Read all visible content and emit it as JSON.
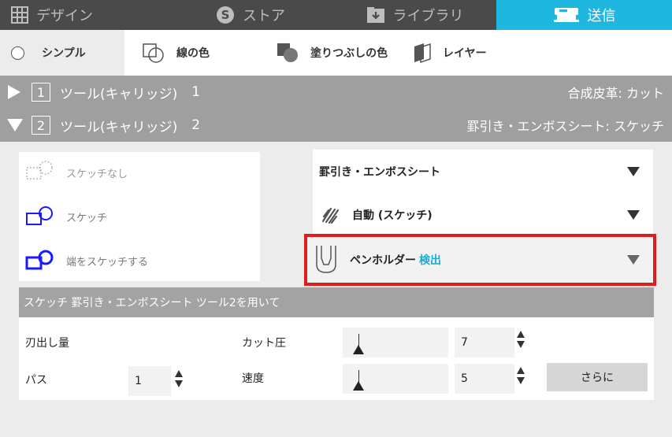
{
  "tabs": [
    {
      "label": "デザイン",
      "icon": "grid-icon"
    },
    {
      "label": "ストア",
      "icon": "store-s-icon"
    },
    {
      "label": "ライブラリ",
      "icon": "library-download-icon"
    },
    {
      "label": "送信",
      "icon": "send-cutter-icon",
      "active": true
    }
  ],
  "style_options": {
    "simple": "シンプル",
    "line_color": "線の色",
    "fill_color": "塗りつぶしの色",
    "layer": "レイヤー"
  },
  "tools": [
    {
      "box": "1",
      "label": "ツール(キャリッジ)",
      "number": "1",
      "material": "合成皮革: カット",
      "expanded": false
    },
    {
      "box": "2",
      "label": "ツール(キャリッジ)",
      "number": "2",
      "material": "罫引き・エンボスシート: スケッチ",
      "expanded": true
    }
  ],
  "sketch_options": [
    {
      "label": "スケッチなし",
      "icon": "no-sketch-icon",
      "color": "#aaaaaa"
    },
    {
      "label": "スケッチ",
      "icon": "sketch-icon",
      "color": "#1a1aff"
    },
    {
      "label": "端をスケッチする",
      "icon": "sketch-edge-icon",
      "color": "#1a1aff"
    }
  ],
  "dropdowns": {
    "material": "罫引き・エンボスシート",
    "action": "自動 (スケッチ)",
    "holder": "ペンホルダー",
    "holder_status": "検出"
  },
  "settings": {
    "header": "スケッチ 罫引き・エンボスシート ツール2を用いて",
    "blade_depth_label": "刃出し量",
    "passes_label": "パス",
    "passes_value": "1",
    "force_label": "カット圧",
    "force_value": "7",
    "force_level": 0.15,
    "speed_label": "速度",
    "speed_value": "5",
    "speed_level": 0.15,
    "more_button": "さらに"
  },
  "colors": {
    "topbar": "#4a4a4a",
    "active_tab": "#1fb6e0",
    "highlight_border": "#e21c1c",
    "detect_text": "#1fa8d8"
  }
}
